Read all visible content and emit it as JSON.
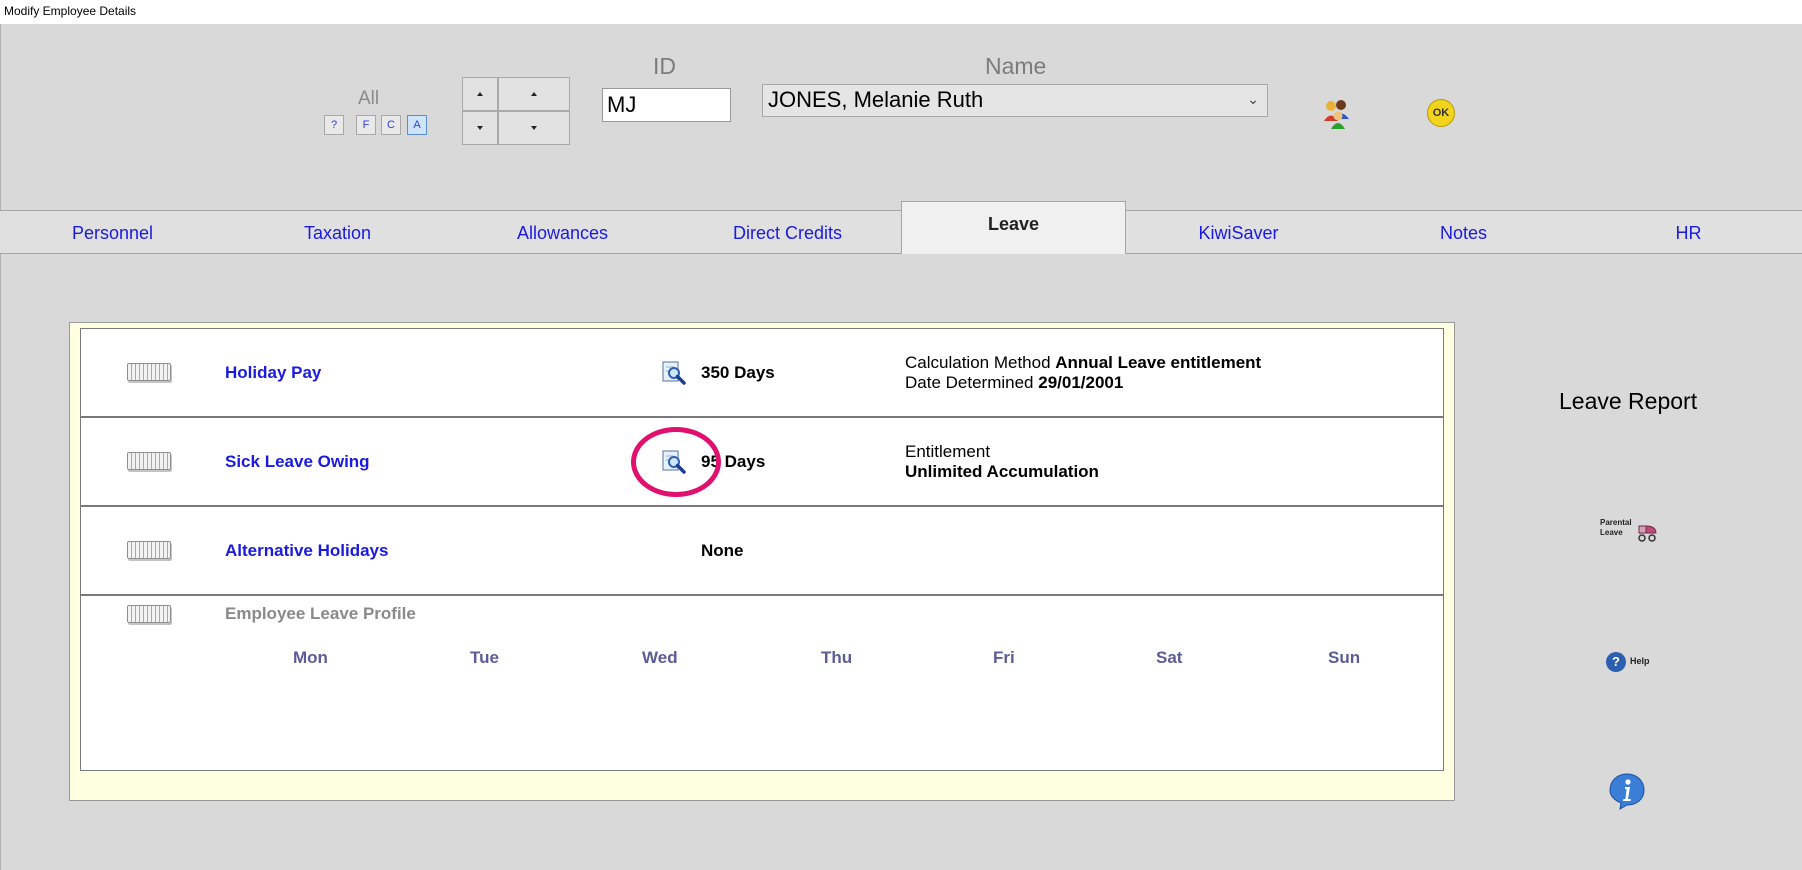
{
  "window": {
    "title": "Modify Employee Details"
  },
  "filter": {
    "label": "All",
    "buttons": [
      "?",
      "F",
      "C",
      "A"
    ],
    "active": "A"
  },
  "nav": {
    "up": "up-arrow",
    "down": "down-arrow",
    "first": "page-up-arrow",
    "last": "page-down-arrow"
  },
  "employee": {
    "id_label": "ID",
    "id_value": "MJ",
    "name_label": "Name",
    "name_value": "JONES, Melanie Ruth"
  },
  "toolbar": {
    "people_icon": "people-icon",
    "ok_label": "OK"
  },
  "tabs": [
    {
      "label": "Personnel"
    },
    {
      "label": "Taxation"
    },
    {
      "label": "Allowances"
    },
    {
      "label": "Direct Credits"
    },
    {
      "label": "Leave",
      "active": true
    },
    {
      "label": "KiwiSaver"
    },
    {
      "label": "Notes"
    },
    {
      "label": "HR"
    }
  ],
  "leave": {
    "holiday_pay": {
      "label": "Holiday Pay",
      "value": "350 Days",
      "calc_prefix": "Calculation Method",
      "calc_value": "Annual Leave entitlement",
      "date_prefix": "Date Determined",
      "date_value": "29/01/2001"
    },
    "sick_leave": {
      "label": "Sick Leave Owing",
      "value": "95 Days",
      "entitlement_label": "Entitlement",
      "entitlement_value": "Unlimited Accumulation"
    },
    "alt_holidays": {
      "label": "Alternative Holidays",
      "value": "None"
    },
    "profile": {
      "label": "Employee Leave Profile",
      "days": [
        "Mon",
        "Tue",
        "Wed",
        "Thu",
        "Fri",
        "Sat",
        "Sun"
      ]
    }
  },
  "side": {
    "leave_report": "Leave Report",
    "parental_line1": "Parental",
    "parental_line2": "Leave",
    "help": "Help",
    "info_icon": "info-icon"
  },
  "colors": {
    "link": "#1a1ae0",
    "highlight": "#e0106e",
    "panel_bg": "#fefee0",
    "ok_yellow": "#f2d41c"
  }
}
